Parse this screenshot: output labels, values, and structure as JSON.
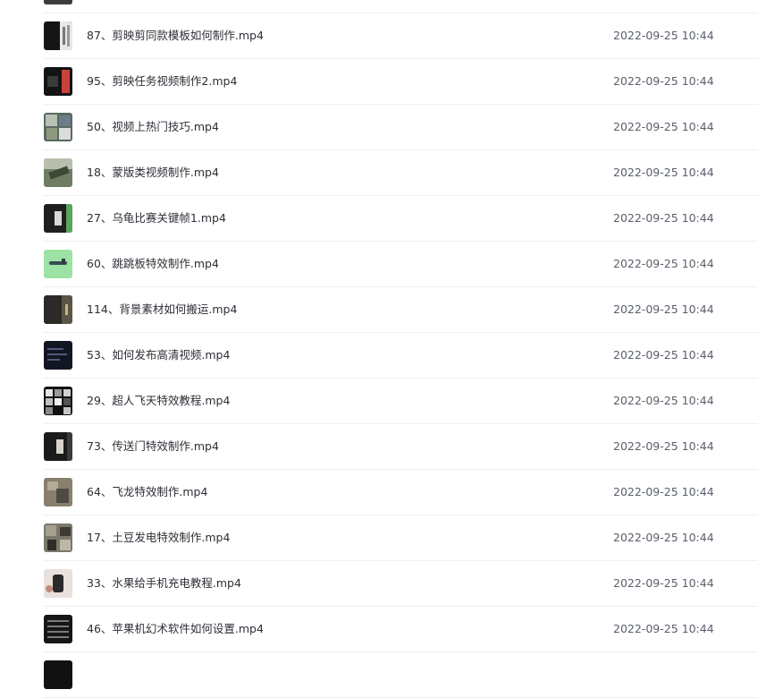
{
  "files": [
    {
      "name": "",
      "time": "",
      "thumb_icon": "video-thumbnail"
    },
    {
      "name": "87、剪映剪同款模板如何制作.mp4",
      "time": "2022-09-25 10:44",
      "thumb_icon": "video-thumbnail"
    },
    {
      "name": "95、剪映任务视频制作2.mp4",
      "time": "2022-09-25 10:44",
      "thumb_icon": "video-thumbnail"
    },
    {
      "name": "50、视频上热门技巧.mp4",
      "time": "2022-09-25 10:44",
      "thumb_icon": "video-thumbnail"
    },
    {
      "name": "18、蒙版类视频制作.mp4",
      "time": "2022-09-25 10:44",
      "thumb_icon": "video-thumbnail"
    },
    {
      "name": "27、乌龟比赛关键帧1.mp4",
      "time": "2022-09-25 10:44",
      "thumb_icon": "video-thumbnail"
    },
    {
      "name": "60、跳跳板特效制作.mp4",
      "time": "2022-09-25 10:44",
      "thumb_icon": "video-thumbnail"
    },
    {
      "name": "114、背景素材如何搬运.mp4",
      "time": "2022-09-25 10:44",
      "thumb_icon": "video-thumbnail"
    },
    {
      "name": "53、如何发布高清视频.mp4",
      "time": "2022-09-25 10:44",
      "thumb_icon": "video-thumbnail"
    },
    {
      "name": "29、超人飞天特效教程.mp4",
      "time": "2022-09-25 10:44",
      "thumb_icon": "video-thumbnail"
    },
    {
      "name": "73、传送门特效制作.mp4",
      "time": "2022-09-25 10:44",
      "thumb_icon": "video-thumbnail"
    },
    {
      "name": "64、飞龙特效制作.mp4",
      "time": "2022-09-25 10:44",
      "thumb_icon": "video-thumbnail"
    },
    {
      "name": "17、土豆发电特效制作.mp4",
      "time": "2022-09-25 10:44",
      "thumb_icon": "video-thumbnail"
    },
    {
      "name": "33、水果给手机充电教程.mp4",
      "time": "2022-09-25 10:44",
      "thumb_icon": "video-thumbnail"
    },
    {
      "name": "46、苹果机幻术软件如何设置.mp4",
      "time": "2022-09-25 10:44",
      "thumb_icon": "video-thumbnail"
    },
    {
      "name": "",
      "time": "",
      "thumb_icon": "video-thumbnail"
    }
  ],
  "colors": {
    "row_border": "#eeeff2",
    "name_text": "#2c2f36",
    "time_text": "#595f6b"
  }
}
